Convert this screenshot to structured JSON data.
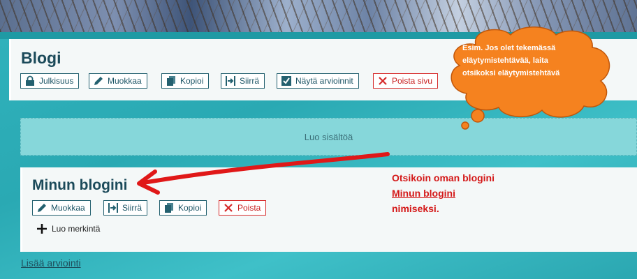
{
  "page_card": {
    "title": "Blogi",
    "buttons": {
      "privacy": "Julkisuus",
      "edit": "Muokkaa",
      "copy": "Kopioi",
      "move": "Siirrä",
      "show_ratings": "Näytä arvioinnit",
      "delete_page": "Poista sivu"
    }
  },
  "drop_zone": {
    "label": "Luo sisältöä"
  },
  "blog_card": {
    "title": "Minun blogini",
    "buttons": {
      "edit": "Muokkaa",
      "move": "Siirrä",
      "copy": "Kopioi",
      "delete": "Poista"
    },
    "create_entry": "Luo merkintä"
  },
  "footer": {
    "add_rating": "Lisää arviointi"
  },
  "annotation": {
    "line1": "Otsikoin oman blogini",
    "line2": "Minun blogini",
    "line3": "nimiseksi."
  },
  "speech_bubble": {
    "line1": "Esim. Jos olet tekemässä",
    "line2": "eläytymistehtävää, laita",
    "line3": "otsikoksi eläytymistehtävä"
  },
  "colors": {
    "background": "#31b3bd",
    "card": "#f4f8f8",
    "button_border": "#23606f",
    "danger": "#d62a2a",
    "annotation": "#d41818",
    "bubble": "#f5821f"
  },
  "icons": {
    "privacy": "lock-icon",
    "edit": "pencil-icon",
    "copy": "copy-icon",
    "move": "move-icon",
    "show_ratings": "checkbox-icon",
    "delete": "close-icon",
    "create_entry": "plus-icon"
  }
}
